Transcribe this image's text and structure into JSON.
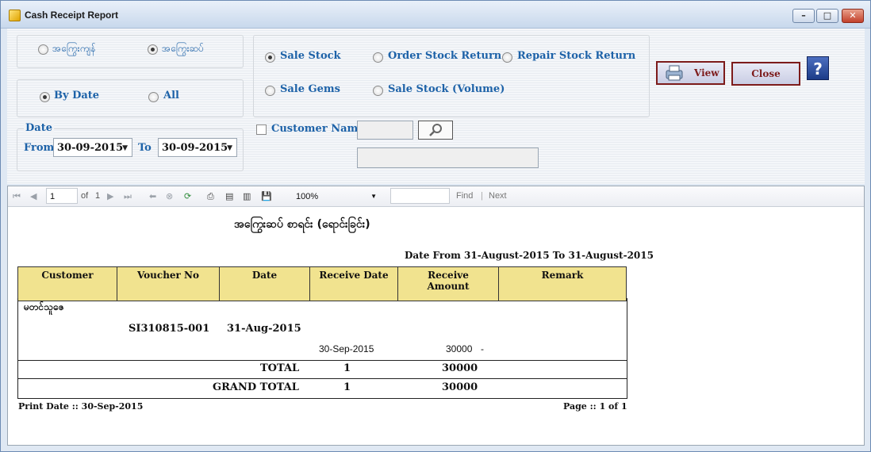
{
  "window": {
    "title": "Cash Receipt Report",
    "minimize_glyph": "–",
    "maximize_glyph": "□",
    "close_glyph": "✕"
  },
  "form": {
    "type_options": [
      "အကြွေးကျန်",
      "အကြွေးဆပ်"
    ],
    "type_selected": "အကြွေးဆပ်",
    "range_options": [
      "By Date",
      "All"
    ],
    "range_selected": "By Date",
    "stock_options": [
      "Sale Stock",
      "Order Stock Return",
      "Repair Stock Return",
      "Sale Gems",
      "Sale Stock (Volume)"
    ],
    "stock_selected": "Sale Stock",
    "date_group_label": "Date",
    "from_label": "From",
    "from_value": "30-09-2015",
    "to_label": "To",
    "to_value": "30-09-2015",
    "customer_label": "Customer Name",
    "customer_checked": false,
    "view_label": "View",
    "close_label": "Close",
    "help_glyph": "?"
  },
  "toolbar": {
    "page_current": "1",
    "page_of": "of",
    "page_total": "1",
    "zoom": "100%",
    "find_label": "Find",
    "next_label": "Next",
    "separator": "|"
  },
  "report": {
    "title": "အကြွေးဆပ် စာရင်း (ရောင်းခြင်း)",
    "date_range": "Date From 31-August-2015  To 31-August-2015",
    "columns": [
      "Customer",
      "Voucher No",
      "Date",
      "Receive Date",
      "Receive Amount",
      "Remark"
    ],
    "customer_name": "မတင်သူဇေ",
    "voucher_no": "SI310815-001",
    "voucher_date": "31-Aug-2015",
    "receive_date": "30-Sep-2015",
    "receive_amount": "30000",
    "remark": "-",
    "total_label": "TOTAL",
    "total_count": "1",
    "total_amount": "30000",
    "grand_total_label": "GRAND TOTAL",
    "grand_total_count": "1",
    "grand_total_amount": "30000",
    "print_date": "Print Date :: 30-Sep-2015",
    "page_info": "Page :: 1 of 1"
  }
}
